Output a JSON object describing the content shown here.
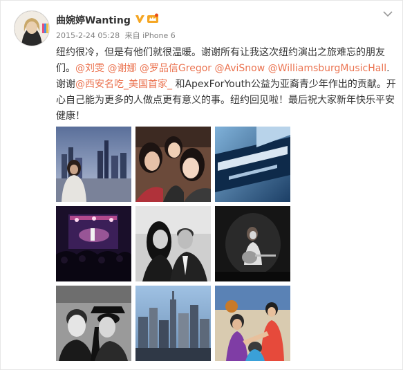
{
  "post": {
    "username": "曲婉婷Wanting",
    "timestamp": "2015-2-24 05:28",
    "source_prefix": "来自",
    "source": "iPhone 6",
    "text_segments": [
      {
        "text": "纽约很冷，但是有他们就很温暖。谢谢所有让我这次纽约演出之旅难忘的朋友们。",
        "type": "plain"
      },
      {
        "text": "@刘雯",
        "type": "mention"
      },
      {
        "text": " ",
        "type": "plain"
      },
      {
        "text": "@谢娜",
        "type": "mention"
      },
      {
        "text": " ",
        "type": "plain"
      },
      {
        "text": "@罗品信Gregor",
        "type": "mention"
      },
      {
        "text": " ",
        "type": "plain"
      },
      {
        "text": "@AviSnow",
        "type": "mention"
      },
      {
        "text": " ",
        "type": "plain"
      },
      {
        "text": "@WilliamsburgMusicHall",
        "type": "mention"
      },
      {
        "text": ". 谢谢",
        "type": "plain"
      },
      {
        "text": "@西安名吃_美国首家_",
        "type": "mention"
      },
      {
        "text": " 和ApexForYouth公益为亚裔青少年作出的贡献。开心自己能为更多的人做点更有意义的事。纽约回见啦！最后祝大家新年快乐平安健康！",
        "type": "plain"
      }
    ]
  },
  "icons": {
    "verified": "verified-v-badge-icon",
    "member": "member-crown-icon",
    "chevron": "chevron-down-icon"
  },
  "colors": {
    "mention": "#eb7350",
    "verified": "#f5a623",
    "meta": "#808080",
    "text": "#333333"
  },
  "photos": [
    {
      "name": "photo-city-skyline-woman",
      "scene": "woman in white coat on rooftop with city skyline"
    },
    {
      "name": "photo-selfie-three-women",
      "scene": "three women selfie"
    },
    {
      "name": "photo-marquee-sign",
      "scene": "venue marquee sign"
    },
    {
      "name": "photo-concert-crowd",
      "scene": "concert crowd with stage"
    },
    {
      "name": "photo-couple-bw",
      "scene": "black and white couple portrait"
    },
    {
      "name": "photo-guitarist-stage",
      "scene": "woman playing guitar on stage"
    },
    {
      "name": "photo-two-friends-bw",
      "scene": "two friends black and white"
    },
    {
      "name": "photo-manhattan-skyline",
      "scene": "Manhattan skyscrapers"
    },
    {
      "name": "photo-kids-basketball",
      "scene": "kids huddle in gym"
    }
  ]
}
